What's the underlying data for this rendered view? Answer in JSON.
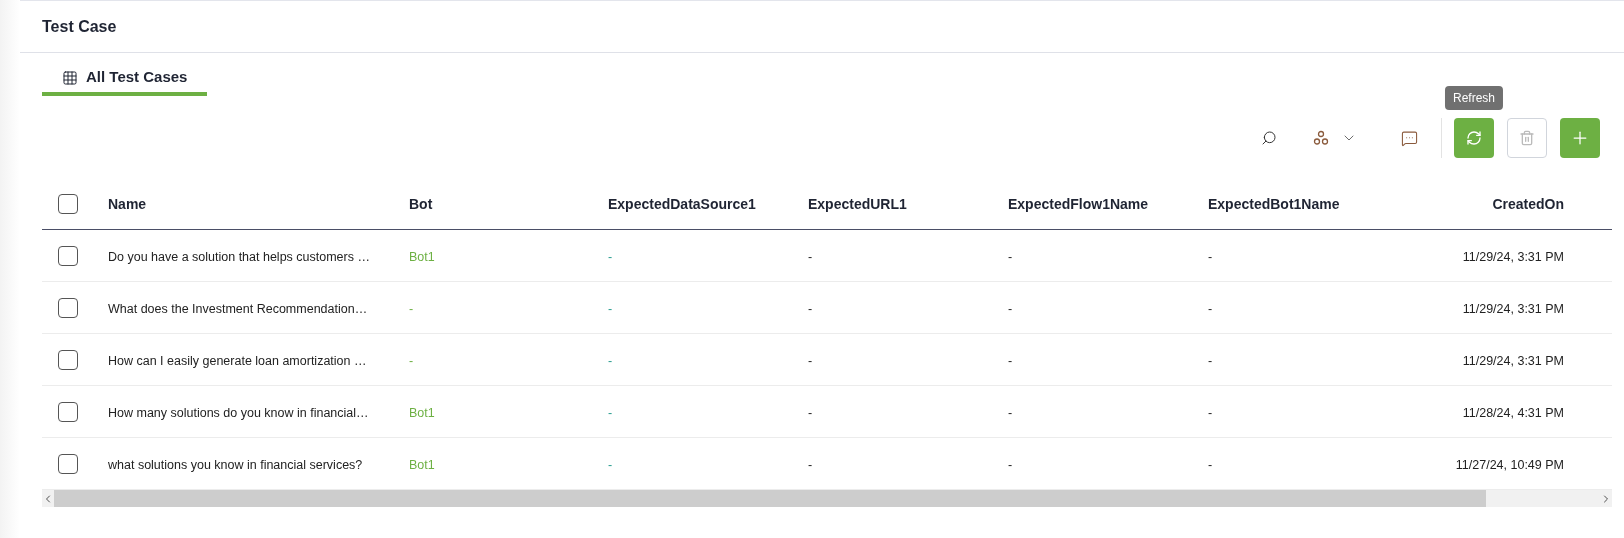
{
  "page": {
    "title": "Test Case"
  },
  "tabs": [
    {
      "label": "All Test Cases",
      "selected": true
    }
  ],
  "toolbar": {
    "tooltip": "Refresh",
    "buttons": [
      {
        "kind": "search",
        "disabled": false
      },
      {
        "kind": "group",
        "disabled": false
      },
      {
        "kind": "comment",
        "disabled": false
      },
      {
        "kind": "refresh",
        "disabled": false
      },
      {
        "kind": "delete",
        "disabled": true
      },
      {
        "kind": "add",
        "disabled": false
      }
    ]
  },
  "table": {
    "header_checked": false,
    "columns": [
      "Name",
      "Bot",
      "ExpectedDataSource1",
      "ExpectedURL1",
      "ExpectedFlow1Name",
      "ExpectedBot1Name",
      "CreatedOn"
    ],
    "rows": [
      {
        "checked": false,
        "cells": [
          "Do you have a solution that helps customers …",
          "Bot1",
          "-",
          "-",
          "-",
          "-",
          "11/29/24, 3:31 PM"
        ]
      },
      {
        "checked": false,
        "cells": [
          "What does the Investment Recommendation…",
          "-",
          "-",
          "-",
          "-",
          "-",
          "11/29/24, 3:31 PM"
        ]
      },
      {
        "checked": false,
        "cells": [
          "How can I easily generate loan amortization …",
          "-",
          "-",
          "-",
          "-",
          "-",
          "11/29/24, 3:31 PM"
        ]
      },
      {
        "checked": false,
        "cells": [
          "How many solutions do you know in financial…",
          "Bot1",
          "-",
          "-",
          "-",
          "-",
          "11/28/24, 4:31 PM"
        ]
      },
      {
        "checked": false,
        "cells": [
          "what solutions you know in financial services?",
          "Bot1",
          "-",
          "-",
          "-",
          "-",
          "11/27/24, 10:49 PM"
        ]
      }
    ]
  }
}
